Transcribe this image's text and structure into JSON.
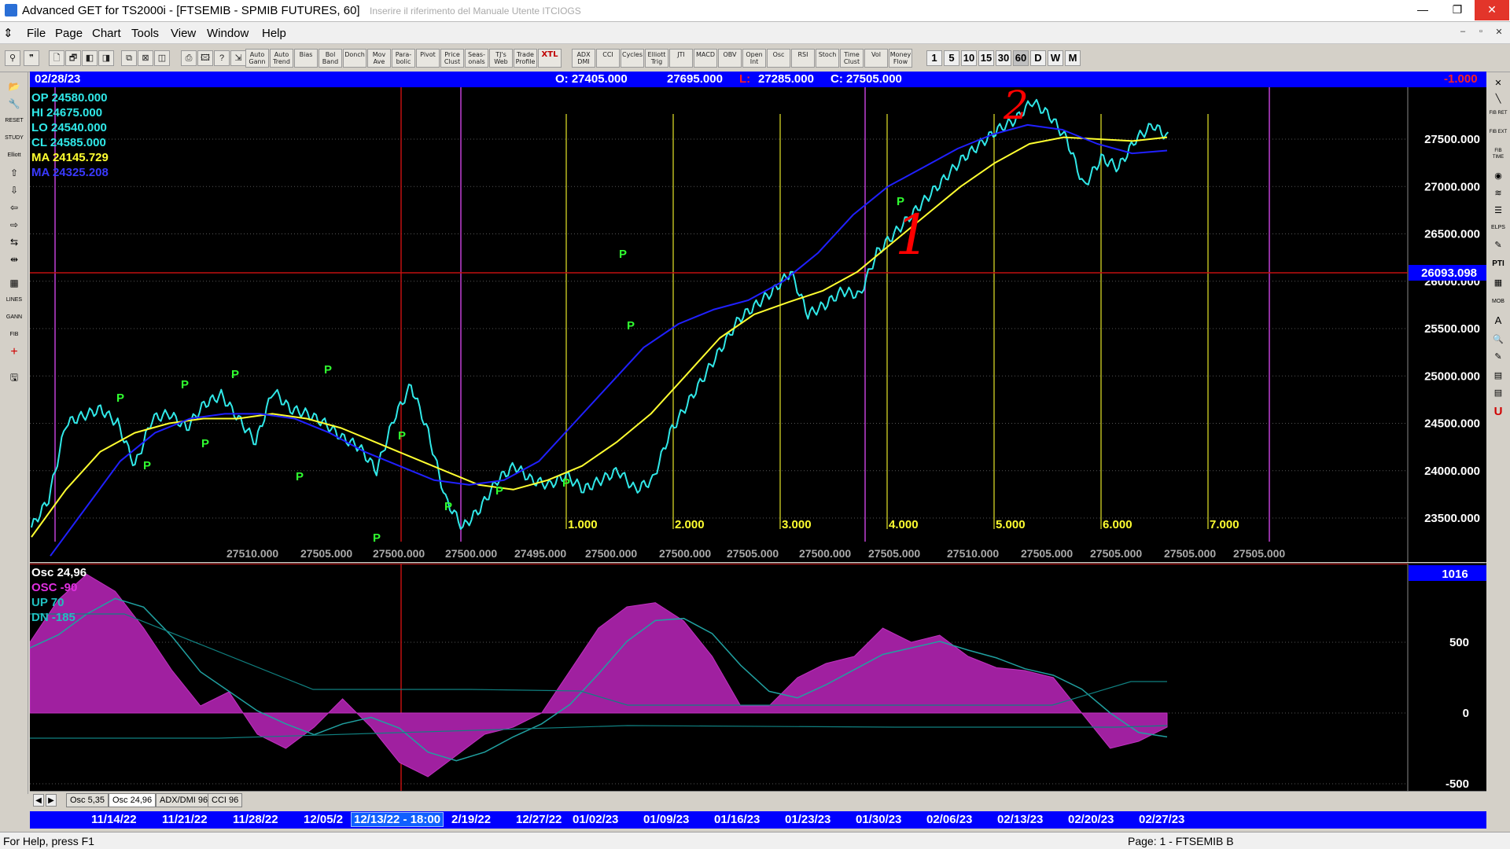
{
  "window": {
    "title": "Advanced GET for TS2000i - [FTSEMIB - SPMIB FUTURES, 60]",
    "blurred_tail": "Inserire il riferimento del Manuale Utente ITCIOGS",
    "min_label": "—",
    "max_label": "❐",
    "close_label": "✕"
  },
  "menu": {
    "items": [
      "File",
      "Page",
      "Chart",
      "Tools",
      "View",
      "Window",
      "Help"
    ],
    "mdi": [
      "–",
      "▫",
      "✕"
    ]
  },
  "toolbar": {
    "icons_left": [
      "⚲",
      "❞"
    ],
    "icons_file": [
      "🗋",
      "🗗",
      "◧",
      "◨",
      "⧉",
      "⊠",
      "◫"
    ],
    "icons_print": [
      "⎙",
      "🖾",
      "?",
      "⇲"
    ],
    "study_buttons": [
      "Auto Gann",
      "Auto Trend",
      "Bias",
      "Bol Band",
      "Donch",
      "Mov Ave",
      "Para-bolic",
      "Pivot",
      "Price Clust",
      "Seas-onals",
      "TJ's Web",
      "Trade Profile",
      "XTL"
    ],
    "indicator_buttons": [
      "ADX DMI",
      "CCI",
      "Cycles",
      "Elliott Trig",
      "JTI",
      "MACD",
      "OBV",
      "Open Int",
      "Osc",
      "RSI",
      "Stoch",
      "Time Clust",
      "Vol",
      "Money Flow"
    ],
    "timeframes": [
      "1",
      "5",
      "10",
      "15",
      "30",
      "60",
      "D",
      "W",
      "M"
    ],
    "active_timeframe": "60"
  },
  "left_tools": [
    "📂",
    "🔧",
    "RESET",
    "STUDY",
    "Elliott",
    "⇧",
    "⇩",
    "⇦",
    "⇨",
    "⇆",
    "⇹",
    "▦",
    "LINES",
    "GANN",
    "FIB",
    "+",
    "🖫"
  ],
  "right_tools": [
    "✕",
    "╲",
    "FIB RET",
    "FIB EXT",
    "FIB TIME",
    "◉",
    "≋",
    "☰",
    "ELPS",
    "✎",
    "PTI",
    "▦",
    "MOB",
    "A",
    "🔍",
    "✎",
    "▤",
    "▤",
    "U"
  ],
  "header": {
    "date": "02/28/23",
    "open": "O: 27405.000",
    "high": "27695.000",
    "low_label": "L:",
    "low": "27285.000",
    "close": "C: 27505.000",
    "change": "-1.000"
  },
  "legend": {
    "op": "OP  24580.000",
    "hi": "HI   24675.000",
    "lo": "LO  24540.000",
    "cl": "CL  24585.000",
    "ma1": "MA  24145.729",
    "ma2": "MA  24325.208"
  },
  "price_axis": {
    "labels": [
      "27500.000",
      "27000.000",
      "26500.000",
      "26000.000",
      "25500.000",
      "25000.000",
      "24500.000",
      "24000.000",
      "23500.000"
    ],
    "current": "26093.098"
  },
  "bottom_values": [
    "27510.000",
    "27505.000",
    "27500.000",
    "27500.000",
    "27495.000",
    "27500.000",
    "27500.000",
    "27505.000",
    "27500.000",
    "27505.000",
    "27510.000",
    "27505.000",
    "27505.000",
    "27505.000",
    "27505.000"
  ],
  "fib_time_labels": [
    "1.000",
    "2.000",
    "3.000",
    "4.000",
    "5.000",
    "6.000",
    "7.000"
  ],
  "pivot_label": "P",
  "annotations": {
    "one": "1",
    "two": "2"
  },
  "colors": {
    "price": "#30e8e8",
    "ma_fast": "#ffff30",
    "ma_slow": "#2020ff",
    "pivot": "#30ff30",
    "fib_time": "#b8b820",
    "cycle": "#9030a0",
    "red_marker": "#c01010",
    "osc_fill": "#a020a0",
    "osc_line": "#20a0a0",
    "annotation": "#ff0000"
  },
  "osc": {
    "title": "Osc 24,96",
    "osc_label": "OSC -90",
    "up_label": "UP   70",
    "dn_label": "DN   -185",
    "axis_top": "1016",
    "axis_labels": [
      "500",
      "0",
      "-500"
    ]
  },
  "tabs": {
    "nav": [
      "◀",
      "▶"
    ],
    "items": [
      "Osc 5,35",
      "Osc 24,96",
      "ADX/DMI 96",
      "CCI 96"
    ],
    "active": "Osc 24,96"
  },
  "date_axis": [
    "11/14/22",
    "11/21/22",
    "11/28/22",
    "12/05/2",
    "12/13/22 - 18:00",
    "2/19/22",
    "12/27/22",
    "01/02/23",
    "01/09/23",
    "01/16/23",
    "01/23/23",
    "01/30/23",
    "02/06/23",
    "02/13/23",
    "02/20/23",
    "02/27/23"
  ],
  "status": {
    "left": "For Help, press F1",
    "right": "Page: 1 - FTSEMIB B"
  },
  "chart_data": {
    "type": "line",
    "title": "FTSEMIB - SPMIB FUTURES, 60",
    "ylim": [
      23150,
      28000
    ],
    "series": [
      {
        "name": "",
        "values": [
          23400,
          23700,
          24500,
          24580,
          24650,
          24500,
          24050,
          24550,
          24600,
          24450,
          24700,
          24800,
          24550,
          24300,
          24850,
          24650,
          24600,
          24500,
          24350,
          24250,
          24000,
          24550,
          24900,
          24400,
          23700,
          23400,
          23600,
          23900,
          24050,
          23900,
          23850,
          23950,
          23800,
          23900,
          24000,
          23800,
          23900,
          24400,
          24700,
          25000,
          25300,
          25600,
          25750,
          25900,
          26100,
          25650,
          25750,
          25900,
          25850,
          26300,
          26500,
          26700,
          26900,
          27100,
          27300,
          27450,
          27600,
          27700,
          27900,
          27750,
          27500,
          27000,
          27300,
          27200,
          27500,
          27650,
          27500
        ]
      },
      {
        "name": "MA",
        "values": [
          23300,
          23800,
          24200,
          24400,
          24500,
          24550,
          24550,
          24600,
          24550,
          24450,
          24300,
          24150,
          24000,
          23850,
          23800,
          23900,
          24050,
          24300,
          24600,
          25000,
          25400,
          25650,
          25780,
          25900,
          26100,
          26400,
          26700,
          27000,
          27250,
          27450,
          27520,
          27500,
          27480,
          27520
        ]
      },
      {
        "name": "MA",
        "values": [
          23100,
          23600,
          24100,
          24400,
          24550,
          24600,
          24600,
          24550,
          24400,
          24200,
          24050,
          23900,
          23850,
          23900,
          24100,
          24500,
          24900,
          25300,
          25550,
          25700,
          25800,
          26000,
          26300,
          26700,
          27000,
          27200,
          27400,
          27550,
          27650,
          27600,
          27450,
          27350,
          27380
        ]
      }
    ],
    "oscillator": {
      "name": "OSC",
      "ylim": [
        -500,
        1016
      ],
      "values": [
        500,
        800,
        980,
        860,
        600,
        300,
        50,
        150,
        -150,
        -250,
        -100,
        100,
        -100,
        -350,
        -450,
        -300,
        -150,
        -100,
        0,
        300,
        600,
        750,
        780,
        650,
        400,
        50,
        50,
        250,
        350,
        400,
        600,
        500,
        550,
        400,
        320,
        300,
        250,
        0,
        -250,
        -200,
        -100
      ]
    }
  }
}
